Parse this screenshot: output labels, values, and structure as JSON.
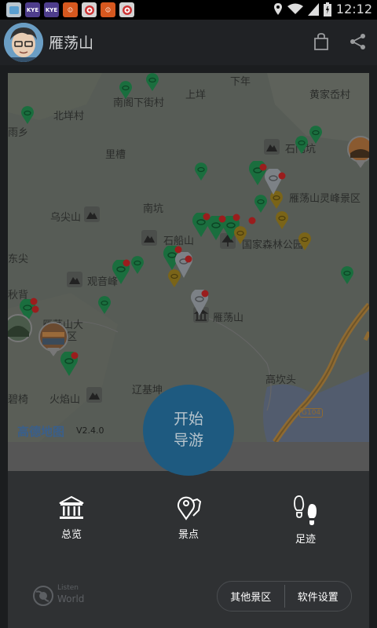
{
  "status_bar": {
    "time": "12:12",
    "notification_icons": [
      "photo-icon",
      "kye-icon",
      "kye-icon",
      "app-icon",
      "target-icon",
      "app-icon",
      "target-icon"
    ],
    "status_icons": [
      "location-icon",
      "wifi-icon",
      "signal-icon",
      "battery-icon"
    ]
  },
  "header": {
    "title": "雁荡山",
    "actions": [
      "bag-icon",
      "share-icon"
    ]
  },
  "map": {
    "places": [
      "下年",
      "南阁下街村",
      "上垟",
      "黄家岙村",
      "北垟村",
      "雨乡",
      "里槽",
      "石门坑",
      "雁荡山灵峰景区",
      "乌尖山",
      "南坑",
      "石船山",
      "国家森林公园",
      "东尖",
      "观音峰",
      "秋背",
      "雁荡山",
      "雁荡山大",
      "景区",
      "高坎头",
      "辽基坤",
      "火焰山",
      "碧椅",
      "G104"
    ],
    "attribution": "高德地图",
    "version": "V2.4.0"
  },
  "start_button": {
    "line1": "开始",
    "line2": "导游"
  },
  "nav": {
    "overview": "总览",
    "spots": "景点",
    "footprints": "足迹"
  },
  "brand": {
    "line1": "Listen",
    "line2": "World"
  },
  "actions": {
    "other_areas": "其他景区",
    "settings": "软件设置"
  },
  "colors": {
    "marker_green": "#1a6e3e",
    "marker_gold": "#7a6418",
    "badge_red": "#9a1d1d",
    "start_button": "#1e5a80",
    "panel": "#2f3133",
    "header": "#202225"
  }
}
